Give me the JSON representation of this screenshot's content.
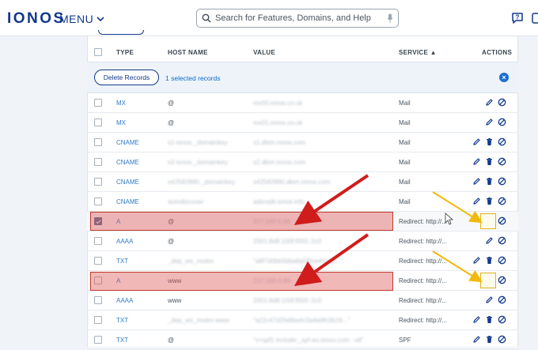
{
  "header": {
    "logo": "IONOS",
    "menu_label": "MENU",
    "search_placeholder": "Search for Features, Domains, and Help",
    "icons": [
      "search-icon",
      "mic-icon",
      "help-chat-icon",
      "account-icon"
    ]
  },
  "table": {
    "columns": {
      "type": "TYPE",
      "host": "HOST NAME",
      "value": "VALUE",
      "service": "SERVICE ▲",
      "actions": "ACTIONS"
    },
    "bulk": {
      "delete_label": "Delete Records",
      "selected_label": "1 selected records"
    },
    "rows": [
      {
        "type": "MX",
        "host": "@",
        "value": "mx00.ionos.co.uk",
        "service": "Mail",
        "checked": false
      },
      {
        "type": "MX",
        "host": "@",
        "value": "mx01.ionos.co.uk",
        "service": "Mail",
        "checked": false
      },
      {
        "type": "CNAME",
        "host": "s1-ionos._domainkey",
        "value": "s1.dkim.ionos.com",
        "service": "Mail",
        "checked": false
      },
      {
        "type": "CNAME",
        "host": "s2-ionos._domainkey",
        "value": "s2.dkim.ionos.com",
        "service": "Mail",
        "checked": false
      },
      {
        "type": "CNAME",
        "host": "s42582890._domainkey",
        "value": "s42582890.dkim.ionos.com",
        "service": "Mail",
        "checked": false
      },
      {
        "type": "CNAME",
        "host": "autodiscover",
        "value": "adsredir.ionos.info",
        "service": "Mail",
        "checked": false
      },
      {
        "type": "A",
        "host": "@",
        "value": "217.160.0.84",
        "service": "Redirect: http://...",
        "checked": true
      },
      {
        "type": "AAAA",
        "host": "@",
        "value": "2001:8d8:100f:f000::2c0",
        "service": "Redirect: http://...",
        "checked": false
      },
      {
        "type": "TXT",
        "host": "_dep_ws_mutex",
        "value": "\"a8f7d0bb5bba8a5f0ce41aa3...\"",
        "service": "Redirect: http://...",
        "checked": false
      },
      {
        "type": "A",
        "host": "www",
        "value": "217.160.0.84",
        "service": "Redirect: http://...",
        "checked": false
      },
      {
        "type": "AAAA",
        "host": "www",
        "value": "2001:8d8:100f:f000::2c0",
        "service": "Redirect: http://...",
        "checked": false
      },
      {
        "type": "TXT",
        "host": "_dep_ws_mutex.www",
        "value": "\"a22c47d2fe8ba4c0a4a9fc0b19...\"",
        "service": "Redirect: http://...",
        "checked": false
      },
      {
        "type": "TXT",
        "host": "@",
        "value": "\"v=spf1 include:_spf-eu.ionos.com ~all\"",
        "service": "SPF",
        "checked": false
      }
    ]
  },
  "colors": {
    "brand": "#11388c",
    "link": "#2f7bc9",
    "highlight_red": "#d9534f",
    "highlight_yellow": "#e0b21a"
  }
}
